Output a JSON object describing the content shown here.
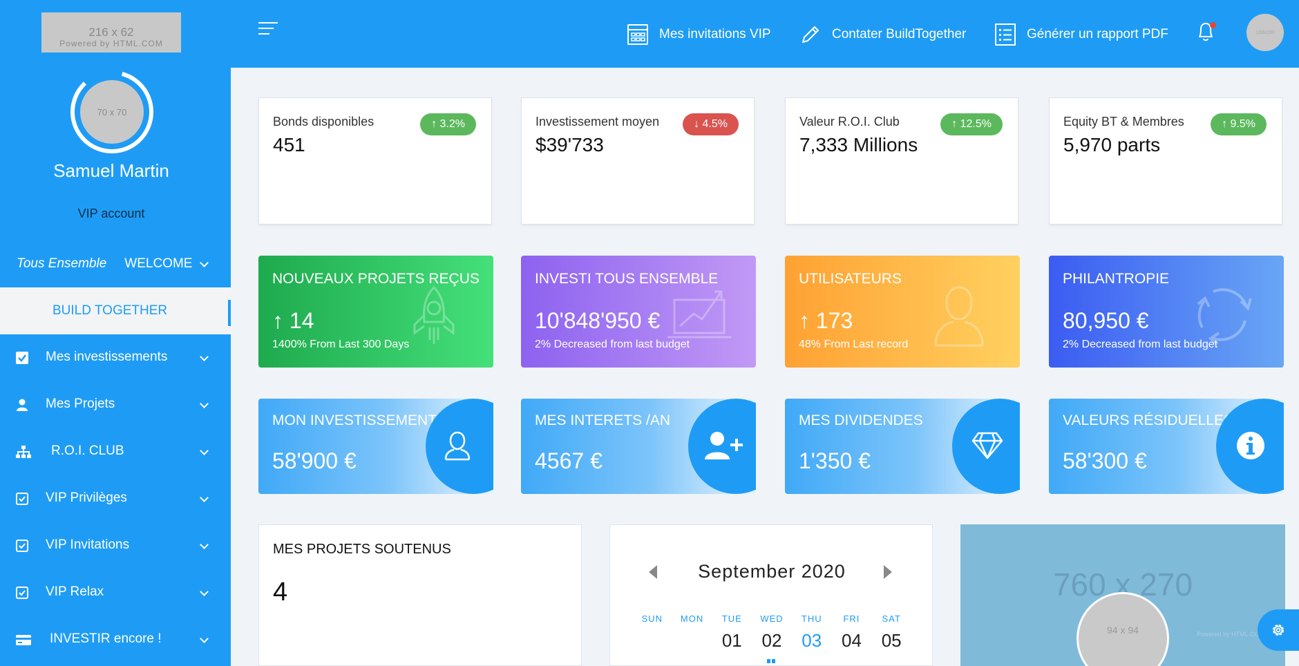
{
  "sidebar": {
    "logo_placeholder": "216 x 62",
    "logo_powered": "Powered by HTML.COM",
    "avatar_placeholder": "70 x 70",
    "user_name": "Samuel Martin",
    "user_role": "VIP account",
    "welcome_brand": "Tous Ensemble",
    "welcome_label": "WELCOME",
    "build_label": "BUILD TOGETHER",
    "items": [
      {
        "label": "Mes investissements",
        "icon": "check-square-icon"
      },
      {
        "label": "Mes Projets",
        "icon": "user-icon"
      },
      {
        "label": "R.O.I. CLUB",
        "icon": "sitemap-icon"
      },
      {
        "label": "VIP Privilèges",
        "icon": "check-square-outline-icon"
      },
      {
        "label": "VIP Invitations",
        "icon": "check-square-outline-icon"
      },
      {
        "label": "VIP Relax",
        "icon": "check-square-outline-icon"
      },
      {
        "label": "INVESTIR encore !",
        "icon": "credit-card-icon"
      }
    ]
  },
  "header": {
    "nav": [
      {
        "label": "Mes invitations VIP",
        "icon": "calendar-grid-icon"
      },
      {
        "label": "Contater BuildTogether",
        "icon": "pencil-icon"
      },
      {
        "label": "Générer un rapport PDF",
        "icon": "list-document-icon"
      }
    ],
    "avatar_placeholder": "150x150"
  },
  "stats": [
    {
      "label": "Bonds disponibles",
      "value": "451",
      "change": "3.2%",
      "direction": "up"
    },
    {
      "label": "Investissement moyen",
      "value": "$39'733",
      "change": "4.5%",
      "direction": "down"
    },
    {
      "label": "Valeur R.O.I. Club",
      "value": "7,333 Millions",
      "change": "12.5%",
      "direction": "up"
    },
    {
      "label": "Equity BT & Membres",
      "value": "5,970 parts",
      "change": "9.5%",
      "direction": "up"
    }
  ],
  "highlights": [
    {
      "title": "NOUVEAUX PROJETS REÇUS",
      "value": "14",
      "arrow": "↑",
      "sub": "1400% From Last 300 Days",
      "icon": "rocket-icon",
      "colors": [
        "#1eaa4e",
        "#45e07a"
      ]
    },
    {
      "title": "INVESTI TOUS ENSEMBLE",
      "value": "10'848'950 €",
      "arrow": "",
      "sub": "2% Decreased from last budget",
      "icon": "laptop-chart-icon",
      "colors": [
        "#8d62f0",
        "#c199f5"
      ]
    },
    {
      "title": "UTILISATEURS",
      "value": "173",
      "arrow": "↑",
      "sub": "48% From Last record",
      "icon": "user-silhouette-icon",
      "colors": [
        "#ffa133",
        "#ffd160"
      ]
    },
    {
      "title": "PHILANTROPIE",
      "value": "80,950 €",
      "arrow": "",
      "sub": "2% Decreased from last budget",
      "icon": "recycle-icon",
      "colors": [
        "#3b5cf2",
        "#68a6f5"
      ]
    }
  ],
  "investments": [
    {
      "title": "MON INVESTISSEMENT",
      "value": "58'900 €",
      "icon": "user-outline-icon"
    },
    {
      "title": "MES INTERETS /AN",
      "value": "4567 €",
      "icon": "user-plus-icon"
    },
    {
      "title": "MES DIVIDENDES",
      "value": "1'350 €",
      "icon": "diamond-icon"
    },
    {
      "title": "VALEURS RÉSIDUELLES",
      "value": "58'300 €",
      "icon": "info-circle-icon"
    }
  ],
  "projects": {
    "title": "MES PROJETS SOUTENUS",
    "value": "4"
  },
  "calendar": {
    "month": "September 2020",
    "days": [
      "SUN",
      "MON",
      "TUE",
      "WED",
      "THU",
      "FRI",
      "SAT"
    ],
    "dates": [
      "",
      "",
      "01",
      "02",
      "03",
      "04",
      "05"
    ],
    "today": "03"
  },
  "banner": {
    "placeholder": "760 x 270",
    "circle_placeholder": "94 x 94",
    "powered": "Powered by HTML.COM"
  },
  "colors": {
    "primary": "#1e9cf5",
    "success": "#5cb85c",
    "danger": "#d9534f"
  }
}
